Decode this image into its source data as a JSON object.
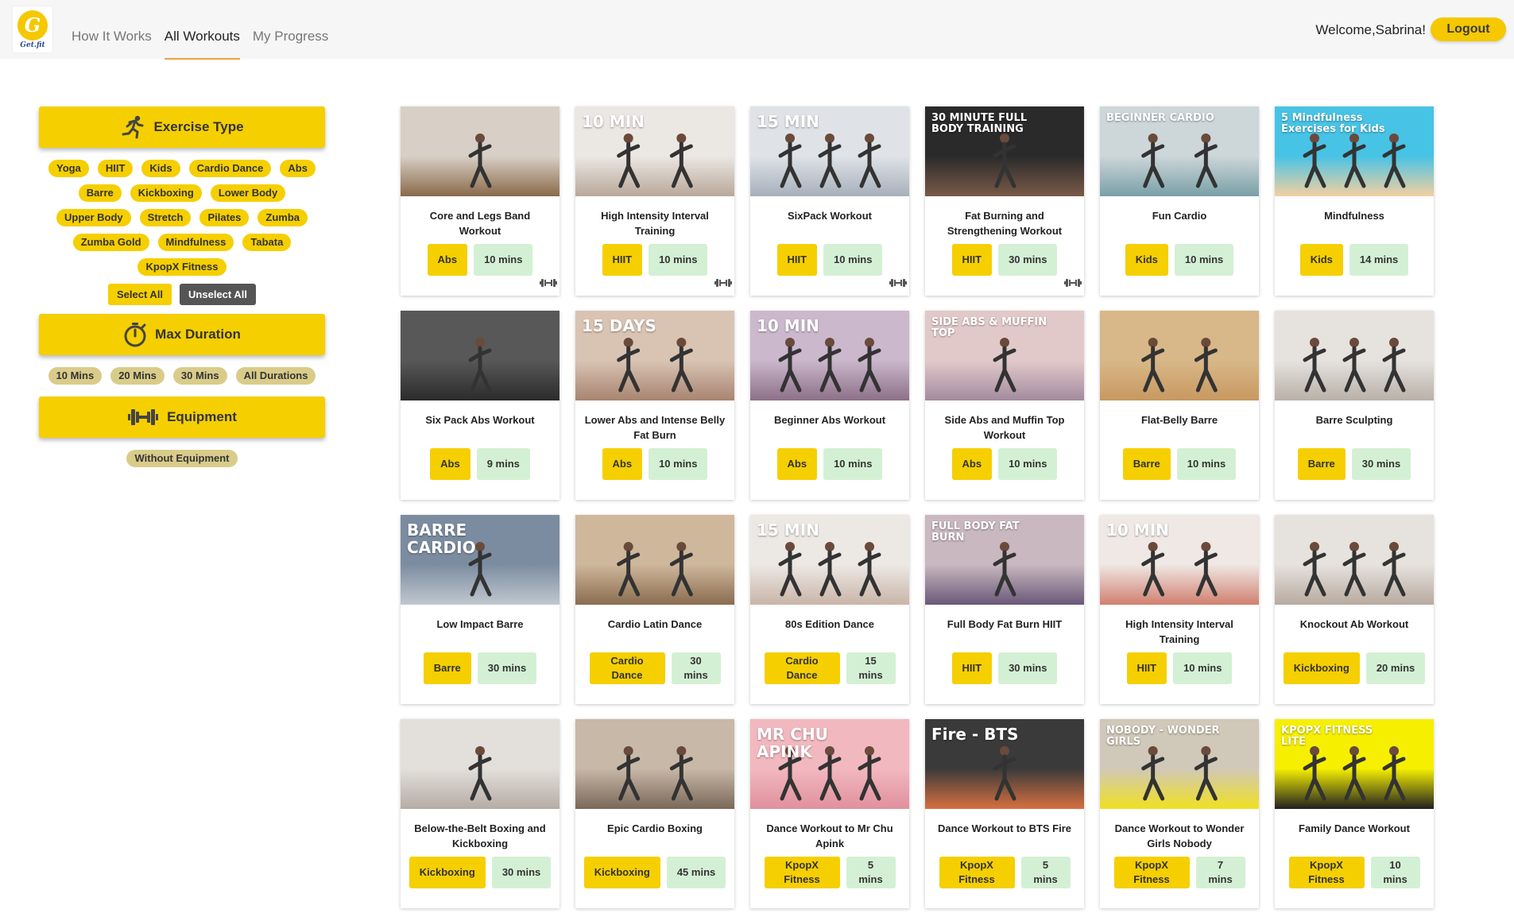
{
  "app": {
    "logo_letter": "G",
    "logo_text": "Get.fit"
  },
  "nav": {
    "links": [
      "How It Works",
      "All Workouts",
      "My Progress"
    ],
    "active": "All Workouts",
    "welcome": "Welcome,Sabrina!",
    "logout": "Logout"
  },
  "sidebar": {
    "exercise_type": {
      "title": "Exercise Type",
      "icon": "running-person-icon",
      "chips": [
        "Yoga",
        "HIIT",
        "Kids",
        "Cardio Dance",
        "Abs",
        "Barre",
        "Kickboxing",
        "Lower Body",
        "Upper Body",
        "Stretch",
        "Pilates",
        "Zumba",
        "Zumba Gold",
        "Mindfulness",
        "Tabata",
        "KpopX Fitness"
      ],
      "select_all": "Select All",
      "unselect_all": "Unselect All"
    },
    "max_duration": {
      "title": "Max Duration",
      "icon": "stopwatch-icon",
      "chips": [
        "10 Mins",
        "20 Mins",
        "30 Mins",
        "All Durations"
      ]
    },
    "equipment": {
      "title": "Equipment",
      "icon": "dumbbell-icon",
      "chips": [
        "Without Equipment"
      ]
    }
  },
  "workouts": [
    {
      "title": "Core and Legs Band Workout",
      "type": "Abs",
      "duration": "10 mins",
      "equipment": true,
      "overlay": ""
    },
    {
      "title": "High Intensity Interval Training",
      "type": "HIIT",
      "duration": "10 mins",
      "equipment": true,
      "overlay": "10 MIN"
    },
    {
      "title": "SixPack Workout",
      "type": "HIIT",
      "duration": "10 mins",
      "equipment": true,
      "overlay": "15 MIN"
    },
    {
      "title": "Fat Burning and Strengthening Workout",
      "type": "HIIT",
      "duration": "30 mins",
      "equipment": true,
      "overlay": "30 MINUTE FULL BODY TRAINING"
    },
    {
      "title": "Fun Cardio",
      "type": "Kids",
      "duration": "10 mins",
      "equipment": false,
      "overlay": "BEGINNER CARDIO"
    },
    {
      "title": "Mindfulness",
      "type": "Kids",
      "duration": "14 mins",
      "equipment": false,
      "overlay": "5 Mindfulness Exercises for Kids"
    },
    {
      "title": "Six Pack Abs Workout",
      "type": "Abs",
      "duration": "9 mins",
      "equipment": false,
      "overlay": ""
    },
    {
      "title": "Lower Abs and Intense Belly Fat Burn",
      "type": "Abs",
      "duration": "10 mins",
      "equipment": false,
      "overlay": "15 DAYS"
    },
    {
      "title": "Beginner Abs Workout",
      "type": "Abs",
      "duration": "10 mins",
      "equipment": false,
      "overlay": "10 MIN"
    },
    {
      "title": "Side Abs and Muffin Top Workout",
      "type": "Abs",
      "duration": "10 mins",
      "equipment": false,
      "overlay": "SIDE ABS & MUFFIN TOP"
    },
    {
      "title": "Flat-Belly Barre",
      "type": "Barre",
      "duration": "10 mins",
      "equipment": false,
      "overlay": ""
    },
    {
      "title": "Barre Sculpting",
      "type": "Barre",
      "duration": "30 mins",
      "equipment": false,
      "overlay": ""
    },
    {
      "title": "Low Impact Barre",
      "type": "Barre",
      "duration": "30 mins",
      "equipment": false,
      "overlay": "BARRE CARDIO"
    },
    {
      "title": "Cardio Latin Dance",
      "type": "Cardio Dance",
      "duration": "30 mins",
      "equipment": false,
      "overlay": ""
    },
    {
      "title": "80s Edition Dance",
      "type": "Cardio Dance",
      "duration": "15 mins",
      "equipment": false,
      "overlay": "15 MIN"
    },
    {
      "title": "Full Body Fat Burn HIIT",
      "type": "HIIT",
      "duration": "30 mins",
      "equipment": false,
      "overlay": "FULL BODY FAT BURN"
    },
    {
      "title": "High Intensity Interval Training",
      "type": "HIIT",
      "duration": "10 mins",
      "equipment": false,
      "overlay": "10 MIN"
    },
    {
      "title": "Knockout Ab Workout",
      "type": "Kickboxing",
      "duration": "20 mins",
      "equipment": false,
      "overlay": ""
    },
    {
      "title": "Below-the-Belt Boxing and Kickboxing",
      "type": "Kickboxing",
      "duration": "30 mins",
      "equipment": false,
      "overlay": ""
    },
    {
      "title": "Epic Cardio Boxing",
      "type": "Kickboxing",
      "duration": "45 mins",
      "equipment": false,
      "overlay": ""
    },
    {
      "title": "Dance Workout to Mr Chu Apink",
      "type": "KpopX Fitness",
      "duration": "5 mins",
      "equipment": false,
      "overlay": "MR CHU APINK"
    },
    {
      "title": "Dance Workout to BTS Fire",
      "type": "KpopX Fitness",
      "duration": "5 mins",
      "equipment": false,
      "overlay": "Fire - BTS"
    },
    {
      "title": "Dance Workout to Wonder Girls Nobody",
      "type": "KpopX Fitness",
      "duration": "7 mins",
      "equipment": false,
      "overlay": "NOBODY - WONDER GIRLS"
    },
    {
      "title": "Family Dance Workout",
      "type": "KpopX Fitness",
      "duration": "10 mins",
      "equipment": false,
      "overlay": "KPOPX FITNESS LITE"
    }
  ],
  "colors": {
    "accent": "#f5cf00",
    "duration_bg": "#d4f0d4",
    "nav_underline": "#f0a040"
  }
}
